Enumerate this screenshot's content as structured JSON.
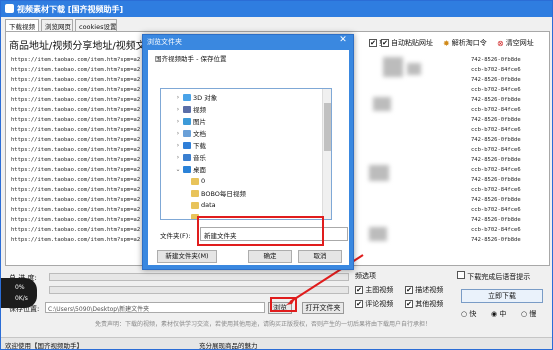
{
  "window": {
    "title": "视频素材下载 [国齐视频助手]"
  },
  "tabs": [
    {
      "label": "下载视频"
    },
    {
      "label": "浏览网页"
    },
    {
      "label": "cookies设置"
    }
  ],
  "header": {
    "label": "商品地址/视频分享地址/视频文件",
    "deselect_check": "✔",
    "deselect_label": "剪",
    "auto_paste_check": "✔",
    "auto_paste_label": "自动粘贴网址",
    "parse_label": "解析淘口令",
    "clear_label": "清空网址"
  },
  "urls_left": [
    "https://item.taobao.com/item.htm?spm=a2",
    "https://item.taobao.com/item.htm?spm=a2",
    "https://item.taobao.com/item.htm?spm=a2",
    "https://item.taobao.com/item.htm?spm=a2",
    "https://item.taobao.com/item.htm?spm=a2",
    "https://item.taobao.com/item.htm?spm=a2",
    "https://item.taobao.com/item.htm?spm=a2",
    "https://item.taobao.com/item.htm?spm=a2",
    "https://item.taobao.com/item.htm?spm=a2",
    "https://item.taobao.com/item.htm?spm=a2",
    "https://item.taobao.com/item.htm?spm=a2",
    "https://item.taobao.com/item.htm?spm=a2",
    "https://item.taobao.com/item.htm?spm=a2",
    "https://item.taobao.com/item.htm?spm=a2",
    "https://item.taobao.com/item.htm?spm=a2",
    "https://item.taobao.com/item.htm?spm=a2",
    "https://item.taobao.com/item.htm?spm=a2",
    "https://item.taobao.com/item.htm?spm=a2",
    "https://item.taobao.com/item.htm?spm=a2"
  ],
  "urls_right": [
    "742-8526-0fb8de",
    "ccb-b702-84fce6",
    "742-8526-0fb8de",
    "ccb-b702-84fce6",
    "742-8526-0fb8de",
    "ccb-b702-84fce6",
    "742-8526-0fb8de",
    "ccb-b702-84fce6",
    "742-8526-0fb8de",
    "ccb-b702-84fce6",
    "742-8526-0fb8de",
    "ccb-b702-84fce6",
    "742-8526-0fb8de",
    "ccb-b702-84fce6",
    "742-8526-0fb8de",
    "ccb-b702-84fce6",
    "742-8526-0fb8de",
    "ccb-b702-84fce6",
    "742-8526-0fb8de"
  ],
  "bottom": {
    "total_progress_label": "总 进 度:",
    "single_progress_label": "单",
    "save_location_label": "保存位置:",
    "save_path": "C:\\Users\\5090\\Desktop\\新建文件夹",
    "browse_label": "浏览",
    "open_folder_label": "打开文件夹",
    "options_title": "频选项",
    "options": [
      {
        "label": "主图视频",
        "checked": "✔"
      },
      {
        "label": "描述视频",
        "checked": "✔"
      },
      {
        "label": "评论视频",
        "checked": "✔"
      },
      {
        "label": "其他视频",
        "checked": "✔"
      }
    ],
    "voice_prompt": "下载完成后语音提示",
    "download_button": "立即下载",
    "speed_options": [
      "快",
      "中",
      "慢"
    ],
    "disclaimer": "免责声明：下载的视频，素材仅供学习交流，若使用其他用途，请购买正版授权，否则产生的一切后果将由下载用户自行承担！"
  },
  "overlay": {
    "line1": "0%",
    "line2": "0K/s"
  },
  "status": {
    "left": "欢迎使用【国齐视频助手】",
    "middle": "充分展现商品的魅力"
  },
  "dialog": {
    "title": "浏览文件夹",
    "close": "✕",
    "description": "国齐视频助手 - 保存位置",
    "tree": [
      {
        "label": "3D 对象",
        "arrow": "›",
        "icon": "3d-objects-icon",
        "color": "#4aa3e8"
      },
      {
        "label": "视频",
        "arrow": "›",
        "icon": "videos-icon",
        "color": "#5a6ea8"
      },
      {
        "label": "图片",
        "arrow": "›",
        "icon": "pictures-icon",
        "color": "#3d9ad8"
      },
      {
        "label": "文档",
        "arrow": "›",
        "icon": "documents-icon",
        "color": "#6aa0d8"
      },
      {
        "label": "下载",
        "arrow": "›",
        "icon": "downloads-icon",
        "color": "#2f7fd8"
      },
      {
        "label": "音乐",
        "arrow": "›",
        "icon": "music-icon",
        "color": "#3a7fd0"
      },
      {
        "label": "桌面",
        "arrow": "⌄",
        "icon": "desktop-icon",
        "color": "#2a82d8"
      },
      {
        "label": "0",
        "arrow": "",
        "icon": "folder-icon",
        "color": "#e8c35a"
      },
      {
        "label": "BOBO每日视频",
        "arrow": "",
        "icon": "folder-icon",
        "color": "#e8c35a"
      },
      {
        "label": "data",
        "arrow": "",
        "icon": "folder-icon",
        "color": "#e8c35a"
      },
      {
        "label": "",
        "arrow": "",
        "icon": "folder-icon",
        "color": "#e8c35a"
      }
    ],
    "folder_label": "文件夹(F):",
    "folder_value": "新建文件夹",
    "new_folder_button": "新建文件夹(M)",
    "ok_button": "确定",
    "cancel_button": "取消"
  },
  "colors": {
    "titlebar": "#2f7de0",
    "highlight": "#e01d1d",
    "dialog_frame": "#3a88e0"
  }
}
